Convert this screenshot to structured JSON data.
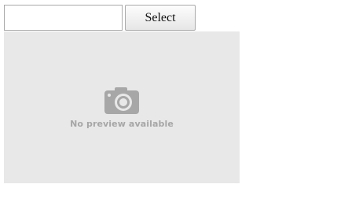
{
  "picker": {
    "input_value": "",
    "select_label": "Select"
  },
  "preview": {
    "message": "No preview available",
    "icon": "camera-icon"
  }
}
